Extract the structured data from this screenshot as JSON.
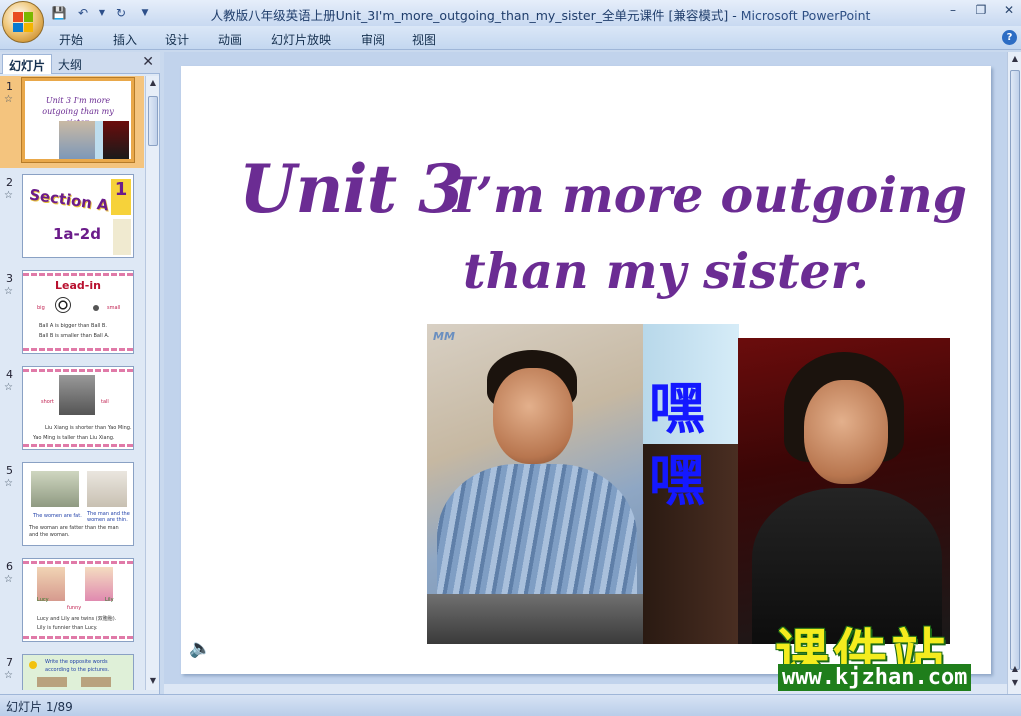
{
  "window": {
    "title": "人教版八年级英语上册Unit_3I'm_more_outgoing_than_my_sister_全单元课件 [兼容模式]",
    "separator": " - ",
    "app_name": "Microsoft PowerPoint"
  },
  "ribbon": {
    "tabs": [
      "开始",
      "插入",
      "设计",
      "动画",
      "幻灯片放映",
      "审阅",
      "视图"
    ]
  },
  "panel": {
    "tab_slides": "幻灯片",
    "tab_outline": "大纲",
    "thumbnails": [
      {
        "num": "1",
        "title": "Unit 3  I'm more outgoing than my sister."
      },
      {
        "num": "2",
        "title": "Section A",
        "sub": "1a-2d",
        "badge": "1"
      },
      {
        "num": "3",
        "title": "Lead-in",
        "words": [
          "big",
          "small"
        ],
        "lines": [
          "Ball A is  bigger than  Ball B.",
          "Ball B is  smaller than  Ball A."
        ]
      },
      {
        "num": "4",
        "words": [
          "short",
          "tall"
        ],
        "lines": [
          "Liu Xiang is  shorter than  Yao Ming.",
          "Yao Ming is  taller than  Liu Xiang."
        ]
      },
      {
        "num": "5",
        "captions": [
          "The women are fat.",
          "The man and the women are thin."
        ],
        "lines": [
          "The woman are fatter than the man and the woman."
        ]
      },
      {
        "num": "6",
        "words": [
          "Lucy",
          "Lily",
          "funny"
        ],
        "lines": [
          "Lucy and Lily are twins (双胞胎).",
          "Lily is  funnier than  Lucy."
        ]
      },
      {
        "num": "7",
        "lines": [
          "Write the opposite  words",
          "according  to the pictures."
        ]
      }
    ]
  },
  "slide": {
    "title_unit": "Unit 3",
    "title_line1": "I’m more outgoing",
    "title_line2": "than my sister.",
    "photo_text": [
      "嘿",
      "嘿"
    ],
    "photo_caption": "MM"
  },
  "watermark": {
    "text": "课件站",
    "url": "www.kjzhan.com"
  },
  "status": {
    "slide_info": "幻灯片 1/89"
  },
  "colors": {
    "title_purple": "#6b2c93",
    "kanji_blue": "#1418ff",
    "watermark_yellow": "#f4ec1e",
    "watermark_green": "#1f7e1b"
  }
}
